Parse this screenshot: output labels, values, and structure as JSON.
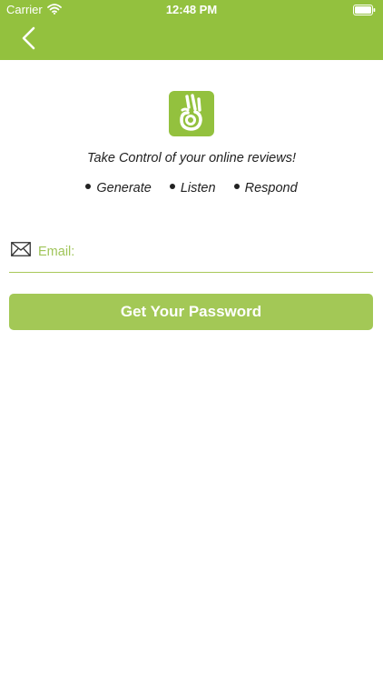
{
  "status_bar": {
    "carrier": "Carrier",
    "time": "12:48 PM"
  },
  "header": {
    "back_icon": "chevron-left-icon"
  },
  "logo_icon": "ok-hand-icon",
  "tagline": "Take Control of your online reviews!",
  "features": [
    "Generate",
    "Listen",
    "Respond"
  ],
  "form": {
    "email_placeholder": "Email:",
    "email_value": "",
    "mail_icon": "envelope-icon",
    "submit_label": "Get Your Password"
  },
  "colors": {
    "brand_green": "#93c13e",
    "button_green": "#a3c856",
    "placeholder_green": "#a0c55a"
  }
}
